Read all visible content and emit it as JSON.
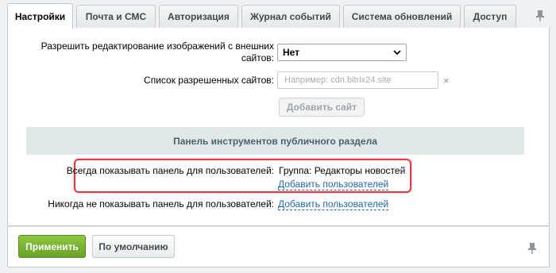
{
  "tabs": [
    {
      "label": "Настройки",
      "active": true
    },
    {
      "label": "Почта и СМС",
      "active": false
    },
    {
      "label": "Авторизация",
      "active": false
    },
    {
      "label": "Журнал событий",
      "active": false
    },
    {
      "label": "Система обновлений",
      "active": false
    },
    {
      "label": "Доступ",
      "active": false
    }
  ],
  "icons": {
    "pin": "pin-icon",
    "clear": "close-icon",
    "chevron": "chevron-down-icon"
  },
  "image_editing": {
    "label": "Разрешить редактирование изображений с внешних сайтов:",
    "value": "Нет"
  },
  "allowed_sites": {
    "label": "Список разрешенных сайтов:",
    "placeholder": "Например: cdn.bitrix24.site",
    "clear": "×",
    "add_button": "Добавить сайт"
  },
  "section": {
    "title": "Панель инструментов публичного раздела"
  },
  "always_show": {
    "label": "Всегда показывать панель для пользователей:",
    "value": "Группа: Редакторы новостей",
    "remove": "×",
    "add_link": "Добавить пользователей"
  },
  "never_show": {
    "label": "Никогда не показывать панель для пользователей:",
    "add_link": "Добавить пользователей"
  },
  "footer": {
    "apply_label": "Применить",
    "default_label": "По умолчанию"
  },
  "colors": {
    "accent_green": "#7bb535",
    "link_blue": "#2067b0",
    "highlight_red": "#e8383d",
    "section_bg": "#e0e8ea"
  }
}
